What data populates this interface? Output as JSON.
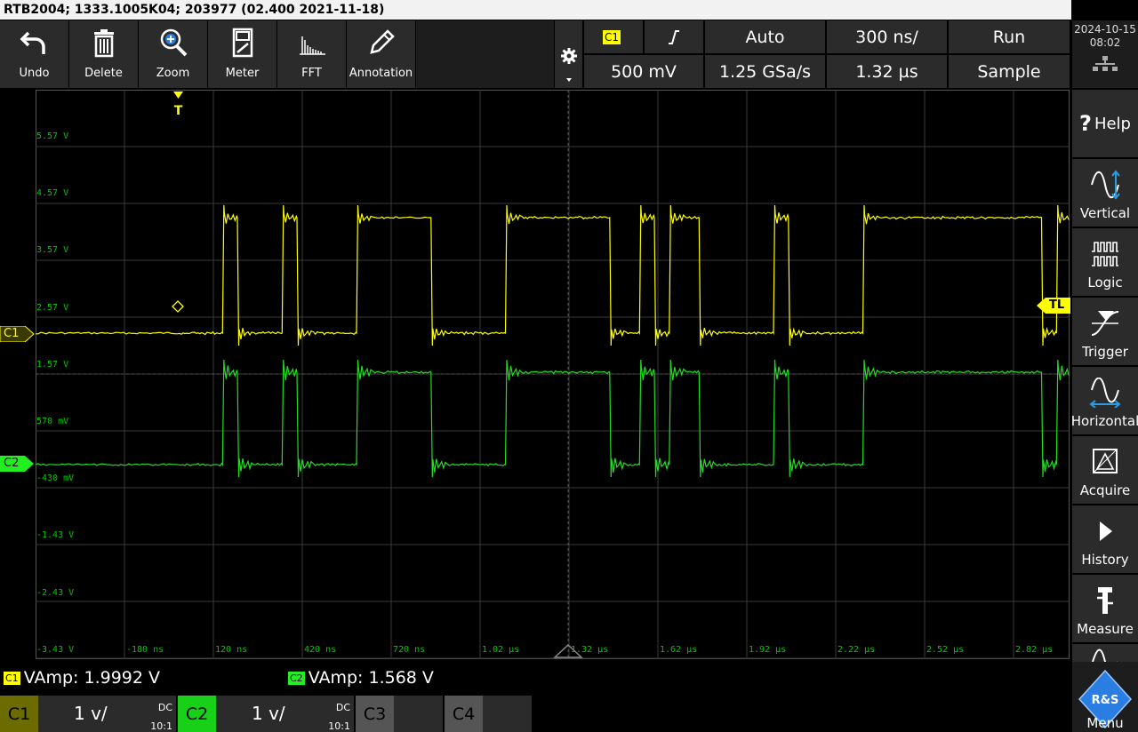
{
  "title": "RTB2004; 1333.1005K04; 203977 (02.400 2021-11-18)",
  "toolbar": {
    "items": [
      {
        "label": "Undo",
        "icon": "undo-icon"
      },
      {
        "label": "Delete",
        "icon": "trash-icon"
      },
      {
        "label": "Zoom",
        "icon": "zoom-icon"
      },
      {
        "label": "Meter",
        "icon": "meter-icon"
      },
      {
        "label": "FFT",
        "icon": "fft-icon"
      },
      {
        "label": "Annotation",
        "icon": "pencil-icon"
      }
    ]
  },
  "horizontal_info": {
    "trigger_source": "C1",
    "trigger_slope": "rising-edge-icon",
    "trigger_mode": "Auto",
    "time_scale": "300 ns/",
    "run_state": "Run",
    "trigger_level": "500 mV",
    "sample_rate": "1.25 GSa/s",
    "time_position": "1.32 µs",
    "acquire_mode": "Sample"
  },
  "clock": {
    "date": "2024-10-15",
    "time": "08:02"
  },
  "sidebar": {
    "items": [
      {
        "label": "Help",
        "icon": "help-icon"
      },
      {
        "label": "Vertical",
        "icon": "vertical-icon"
      },
      {
        "label": "Logic",
        "icon": "logic-icon"
      },
      {
        "label": "Trigger",
        "icon": "trigger-icon"
      },
      {
        "label": "Horizontal",
        "icon": "horizontal-icon"
      },
      {
        "label": "Acquire",
        "icon": "acquire-icon"
      },
      {
        "label": "History",
        "icon": "play-icon"
      },
      {
        "label": "Measure",
        "icon": "measure-icon"
      },
      {
        "label": "",
        "icon": "waveform-icon"
      }
    ],
    "menu_label": "Menu",
    "logo_text": "R&S"
  },
  "scope": {
    "y_labels": [
      "5.57 V",
      "4.57 V",
      "3.57 V",
      "2.57 V",
      "1.57 V",
      "570 mV",
      "-430 mV",
      "-1.43 V",
      "-2.43 V",
      "-3.43 V"
    ],
    "x_labels": [
      "-180 ns",
      "120 ns",
      "420 ns",
      "720 ns",
      "1.02 µs",
      "1.32 µs",
      "1.62 µs",
      "1.92 µs",
      "2.22 µs",
      "2.52 µs",
      "2.82 µs"
    ],
    "trigger_marker": "T",
    "trigger_level_marker": "TL",
    "ch1_marker": "C1",
    "ch2_marker": "C2",
    "colors": {
      "ch1": "#ffff00",
      "ch2": "#22dd22",
      "grid": "#3a3a3a",
      "label": "#00c800"
    }
  },
  "measurements": [
    {
      "channel": "C1",
      "text": "VAmp: 1.9992 V",
      "color": "#ffff00"
    },
    {
      "channel": "C2",
      "text": "VAmp: 1.568 V",
      "color": "#22ee22"
    }
  ],
  "channels": [
    {
      "name": "C1",
      "scale": "1 v/",
      "coupling": "DC",
      "probe": "10:1",
      "color": "#ffff00",
      "bg": "#6b6b00"
    },
    {
      "name": "C2",
      "scale": "1 v/",
      "coupling": "DC",
      "probe": "10:1",
      "color": "#22ee22",
      "bg": "#18c018"
    },
    {
      "name": "C3",
      "scale": "",
      "coupling": "",
      "probe": "",
      "color": "#888888",
      "bg": "#555555"
    },
    {
      "name": "C4",
      "scale": "",
      "coupling": "",
      "probe": "",
      "color": "#888888",
      "bg": "#555555"
    }
  ]
}
